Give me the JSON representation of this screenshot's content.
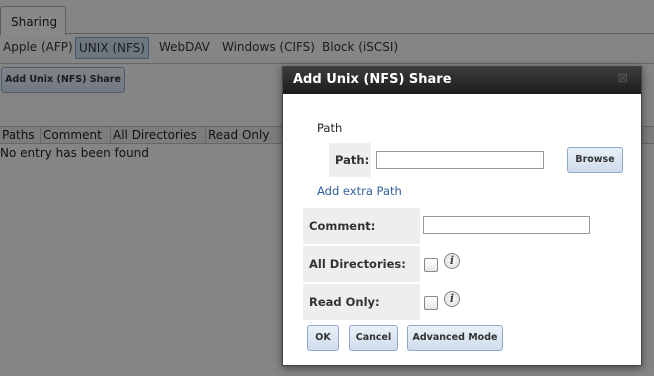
{
  "page": {
    "top_tab": "Sharing",
    "subtabs": [
      "Apple (AFP)",
      "UNIX (NFS)",
      "WebDAV",
      "Windows (CIFS)",
      "Block (iSCSI)"
    ],
    "add_share_label": "Add Unix (NFS) Share",
    "grid_columns": [
      "Paths",
      "Comment",
      "All Directories",
      "Read Only"
    ],
    "empty_message": "No entry has been found"
  },
  "dialog": {
    "title": "Add Unix (NFS) Share",
    "close_icon": "close-icon",
    "section_label": "Path",
    "path_label": "Path:",
    "path_value": "",
    "browse_label": "Browse",
    "add_extra_path": "Add extra Path",
    "comment_label": "Comment:",
    "comment_value": "",
    "all_directories_label": "All Directories:",
    "read_only_label": "Read Only:",
    "info_icon": "i",
    "ok_label": "OK",
    "cancel_label": "Cancel",
    "advanced_label": "Advanced Mode"
  }
}
